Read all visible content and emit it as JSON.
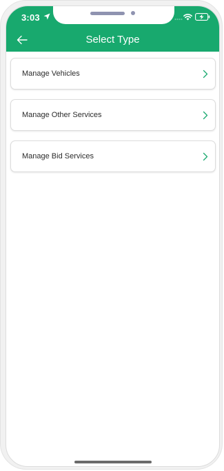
{
  "status_bar": {
    "time": "3:03"
  },
  "header": {
    "title": "Select Type",
    "background_color": "#18a96e"
  },
  "menu": {
    "items": [
      {
        "label": "Manage Vehicles"
      },
      {
        "label": "Manage Other Services"
      },
      {
        "label": "Manage Bid Services"
      }
    ],
    "chevron_color": "#18a96e"
  },
  "icons": {
    "back": "arrow-left-icon",
    "location": "location-arrow-icon",
    "wifi": "wifi-icon",
    "battery": "battery-charging-icon",
    "chevron": "chevron-right-icon"
  }
}
